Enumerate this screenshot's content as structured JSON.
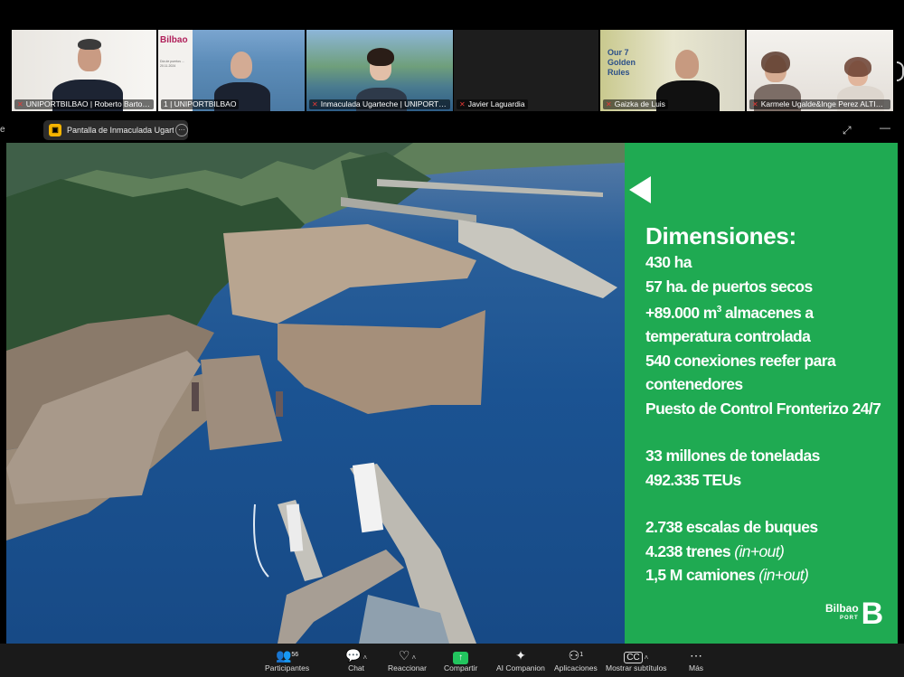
{
  "participants": [
    {
      "name": "UNIPORTBILBAO | Roberto Bartolomé",
      "muted": true
    },
    {
      "name": "1 | UNIPORTBILBAO",
      "muted": false,
      "slide_logo": "Bilbao",
      "slide_subtitle": "Día de puertos ... 20.11.2024"
    },
    {
      "name": "Inmaculada Ugarteche | UNIPORTBILBAO",
      "muted": true
    },
    {
      "name": "Javier Laguardia",
      "muted": true
    },
    {
      "name": "Gaizka de Luis",
      "muted": true,
      "wall_text": "Our 7 Golden Rules"
    },
    {
      "name": "Karmele Ugalde&Inge Perez ALTIUS ...",
      "muted": true
    }
  ],
  "share_bar": {
    "left_fragment": "e",
    "label": "Pantalla de Inmaculada Ugartech",
    "more_icon": "more-icon",
    "expand_icon": "expand-icon",
    "minimize_icon": "minimize-icon"
  },
  "slide": {
    "title": "Dimensiones:",
    "lines": [
      {
        "text": "430 ha"
      },
      {
        "text": "57 ha. de puertos secos"
      },
      {
        "text": "+89.000 m",
        "sup": "3",
        "after": " almacenes a"
      },
      {
        "text": "temperatura controlada"
      },
      {
        "text": "540 conexiones reefer para"
      },
      {
        "text": "contenedores"
      },
      {
        "text": "Puesto de Control Fronterizo 24/7"
      }
    ],
    "lines2": [
      {
        "text": "33 millones de toneladas"
      },
      {
        "text": "492.335 TEUs"
      }
    ],
    "lines3": [
      {
        "text": "2.738 escalas de buques"
      },
      {
        "text": "4.238 trenes ",
        "em": "(in+out)"
      },
      {
        "text": "1,5 M camiones ",
        "em": "(in+out)"
      }
    ],
    "logo_word": "Bilbao",
    "logo_sub": "PORT",
    "logo_letter": "B",
    "panel_color": "#1faa52"
  },
  "controls": [
    {
      "label": "Participantes",
      "icon": "people-icon",
      "count": "56"
    },
    {
      "label": "Chat",
      "icon": "chat-icon"
    },
    {
      "label": "Reaccionar",
      "icon": "heart-icon"
    },
    {
      "label": "Compartir",
      "icon": "share-icon"
    },
    {
      "label": "AI Companion",
      "icon": "sparkle-icon"
    },
    {
      "label": "Aplicaciones",
      "icon": "apps-icon",
      "count": "1"
    },
    {
      "label": "Mostrar subtítulos",
      "icon": "cc-icon"
    },
    {
      "label": "Más",
      "icon": "more-icon"
    }
  ]
}
